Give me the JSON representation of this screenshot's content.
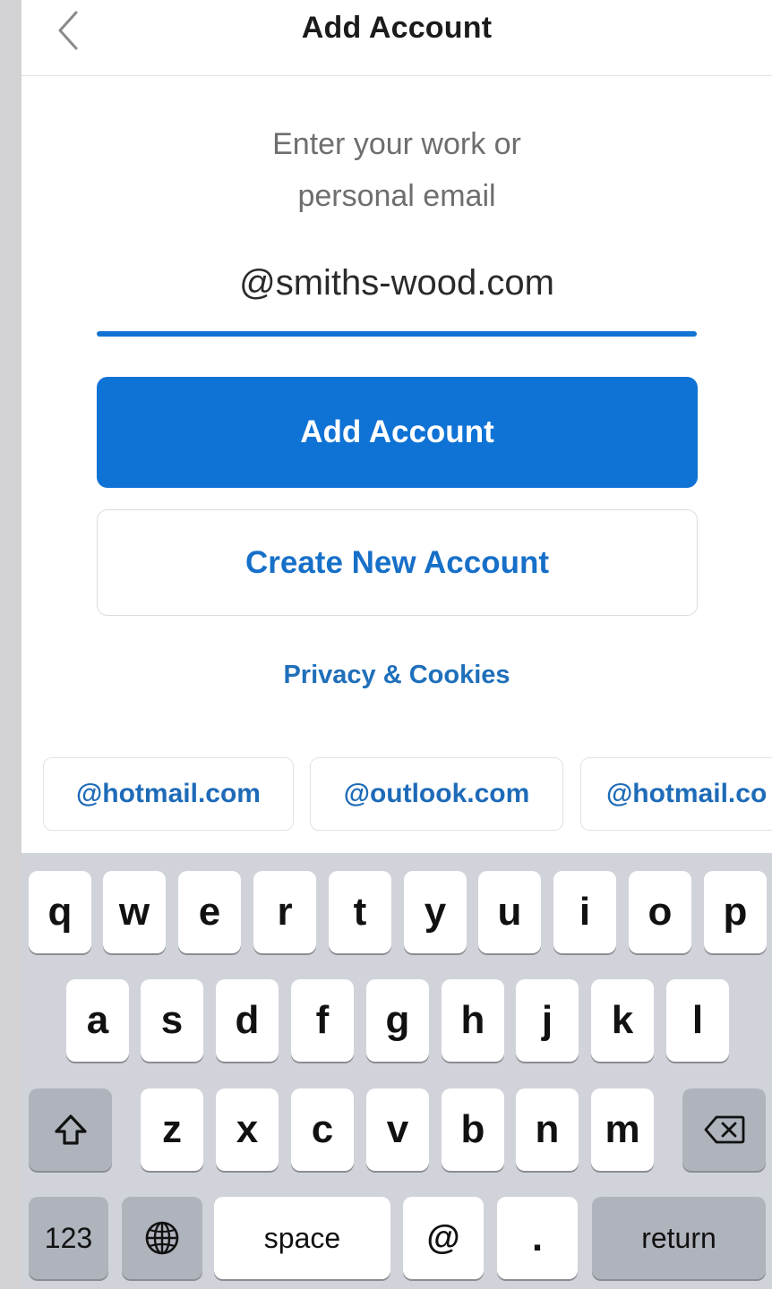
{
  "header": {
    "title": "Add Account",
    "back_icon": "chevron-left-icon"
  },
  "prompt": "Enter your work or\npersonal email",
  "email": {
    "value": "@smiths-wood.com"
  },
  "buttons": {
    "add_account": "Add Account",
    "create_new_account": "Create New Account",
    "privacy": "Privacy & Cookies"
  },
  "suggestions": [
    "@hotmail.com",
    "@outlook.com",
    "@hotmail.co"
  ],
  "keyboard": {
    "row1": [
      "q",
      "w",
      "e",
      "r",
      "t",
      "y",
      "u",
      "i",
      "o",
      "p"
    ],
    "row2": [
      "a",
      "s",
      "d",
      "f",
      "g",
      "h",
      "j",
      "k",
      "l"
    ],
    "row3": [
      "z",
      "x",
      "c",
      "v",
      "b",
      "n",
      "m"
    ],
    "shift_icon": "shift-icon",
    "delete_icon": "backspace-icon",
    "globe_icon": "globe-icon",
    "numbers": "123",
    "space": "space",
    "at": "@",
    "dot": ".",
    "return": "return"
  },
  "colors": {
    "accent": "#0f72d5",
    "link": "#1f6fba",
    "keyboard_bg": "#d0d3d9"
  }
}
